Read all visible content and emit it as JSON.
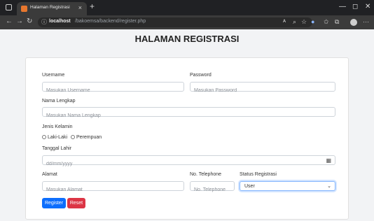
{
  "browser": {
    "tab_title": "Halaman Registrasi",
    "tab_close": "×",
    "new_tab": "+",
    "url_info": "ⓘ",
    "url_host": "localhost",
    "url_path": "/bakoemsa/backend/register.php",
    "back": "←",
    "forward": "→",
    "reload": "↻",
    "min": "—",
    "max": "◻",
    "close": "✕",
    "more": "···"
  },
  "page": {
    "title": "HALAMAN REGISTRASI"
  },
  "form": {
    "username": {
      "label": "Username",
      "placeholder": "Masukan Username"
    },
    "password": {
      "label": "Password",
      "placeholder": "Masukan Password"
    },
    "fullname": {
      "label": "Nama Lengkap",
      "placeholder": "Masukan Nama Lengkap"
    },
    "gender": {
      "label": "Jenis Kelamin",
      "options": [
        "Laki-Laki",
        "Perempuan"
      ]
    },
    "birthdate": {
      "label": "Tanggal Lahir",
      "placeholder": "dd/mm/yyyy"
    },
    "address": {
      "label": "Alamat",
      "placeholder": "Masukan Alamat"
    },
    "phone": {
      "label": "No. Telephone",
      "placeholder": "No. Telephone"
    },
    "status": {
      "label": "Status Registrasi",
      "value": "User"
    },
    "register_label": "Register",
    "reset_label": "Reset"
  },
  "colors": {
    "primary": "#0d6efd",
    "danger": "#dc3545"
  }
}
